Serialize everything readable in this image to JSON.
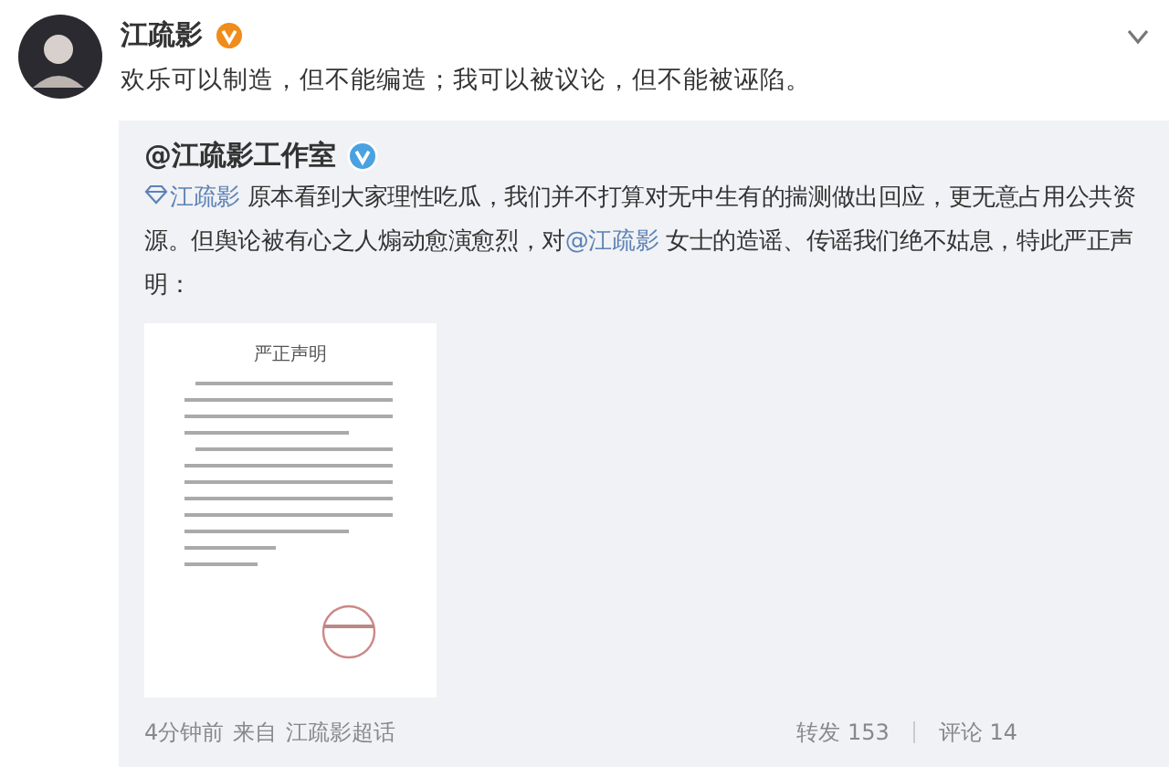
{
  "post": {
    "author": "江疏影",
    "verified": true,
    "text": "欢乐可以制造，但不能编造；我可以被议论，但不能被诬陷。",
    "menu_open": false
  },
  "repost": {
    "author": "@江疏影工作室",
    "verified": true,
    "paragraph": [
      {
        "kind": "topic",
        "text": "江疏影"
      },
      {
        "kind": "text",
        "text": " 原本看到大家理性吃瓜，我们并不打算对无中生有的揣测做出回应，更无意占用公共资源。但舆论被有心之人煽动愈演愈烈，对"
      },
      {
        "kind": "mention",
        "text": "@江疏影"
      },
      {
        "kind": "text",
        "text": " 女士的造谣、传谣我们绝不姑息，特此严正声明："
      }
    ],
    "document": {
      "title": "严正声明"
    },
    "time": "4分钟前",
    "source_label": "来自",
    "source": "江疏影超话",
    "stats": [
      {
        "label": "转发",
        "count": "153"
      },
      {
        "label": "评论",
        "count": "14"
      }
    ]
  }
}
